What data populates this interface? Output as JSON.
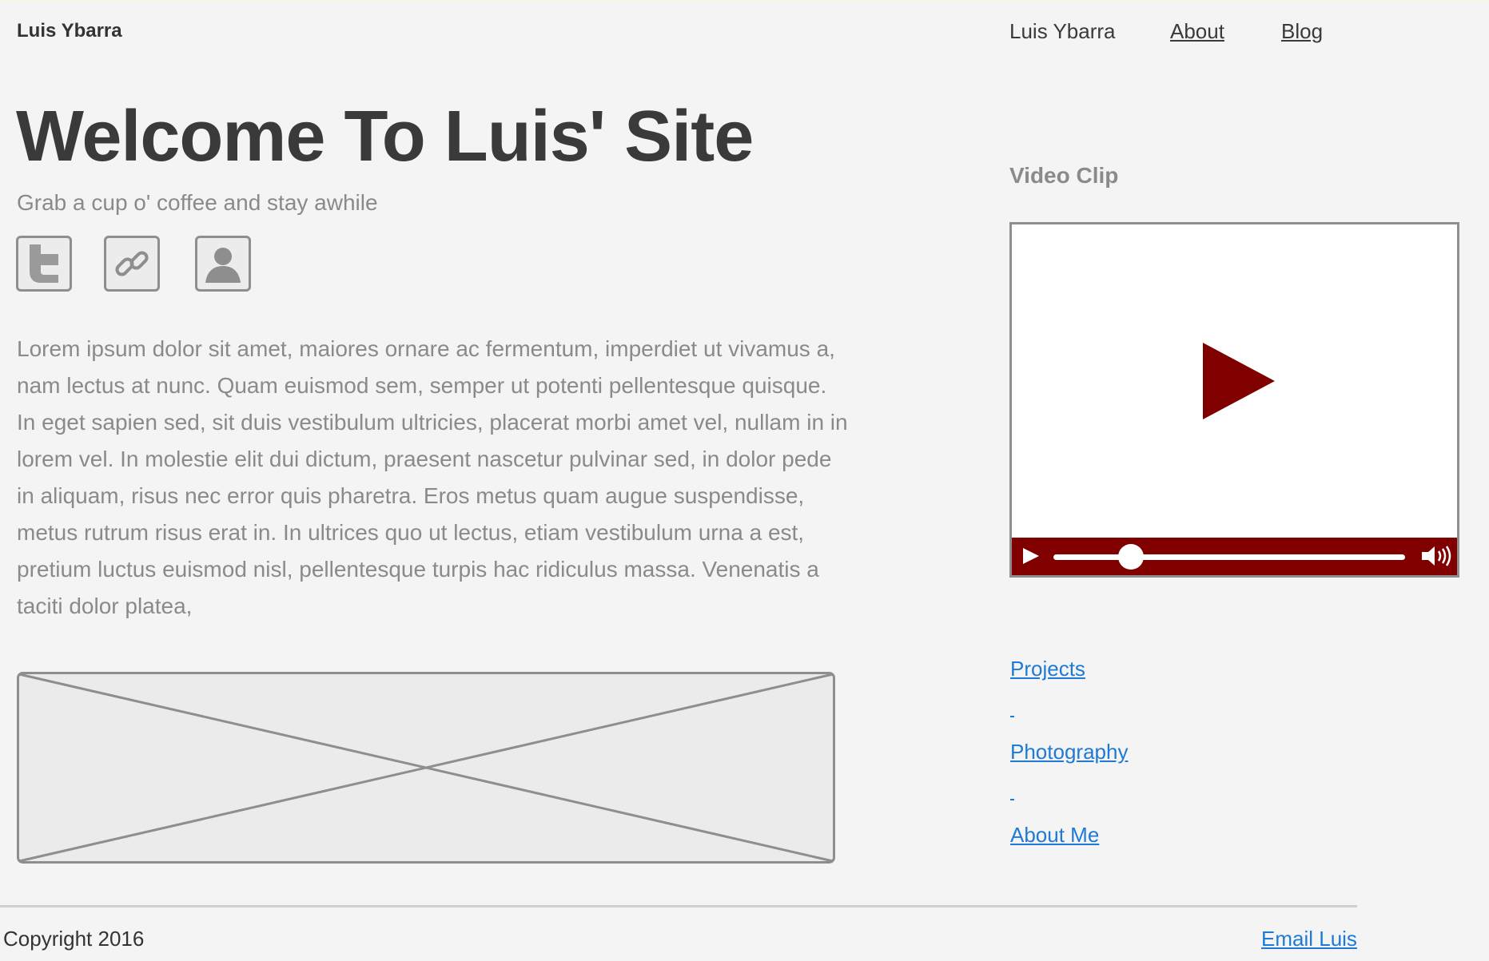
{
  "header": {
    "brand": "Luis Ybarra",
    "nav": {
      "name": "Luis Ybarra",
      "about": "About",
      "blog": "Blog"
    }
  },
  "hero": {
    "title": "Welcome To Luis' Site",
    "subtitle": "Grab a cup o' coffee and stay awhile"
  },
  "social": [
    {
      "icon": "twitter-icon"
    },
    {
      "icon": "link-icon"
    },
    {
      "icon": "profile-icon"
    }
  ],
  "body": {
    "paragraph": "Lorem ipsum dolor sit amet, maiores ornare ac fermentum, imperdiet ut vivamus a, nam lectus at nunc. Quam euismod sem, semper ut potenti pellentesque quisque. In eget sapien sed, sit duis vestibulum ultricies, placerat morbi amet vel, nullam in in lorem vel. In molestie elit dui dictum, praesent nascetur pulvinar sed, in dolor pede in aliquam, risus nec error quis pharetra. Eros metus quam augue suspendisse, metus rutrum risus erat in.  In ultrices quo ut lectus, etiam vestibulum urna a est, pretium luctus euismod nisl, pellentesque turpis hac ridiculus massa. Venenatis a taciti dolor platea,"
  },
  "video": {
    "heading": "Video Clip",
    "progress": 0.22,
    "accent_color": "#800000"
  },
  "side_links": {
    "projects": "Projects",
    "photography": "Photography",
    "about_me": "About Me"
  },
  "footer": {
    "copyright": "Copyright 2016",
    "email": "Email Luis"
  },
  "colors": {
    "link": "#1e7ad4",
    "text": "#3a3a3a",
    "muted": "#8a8a8a",
    "background": "#f4f4f4"
  }
}
